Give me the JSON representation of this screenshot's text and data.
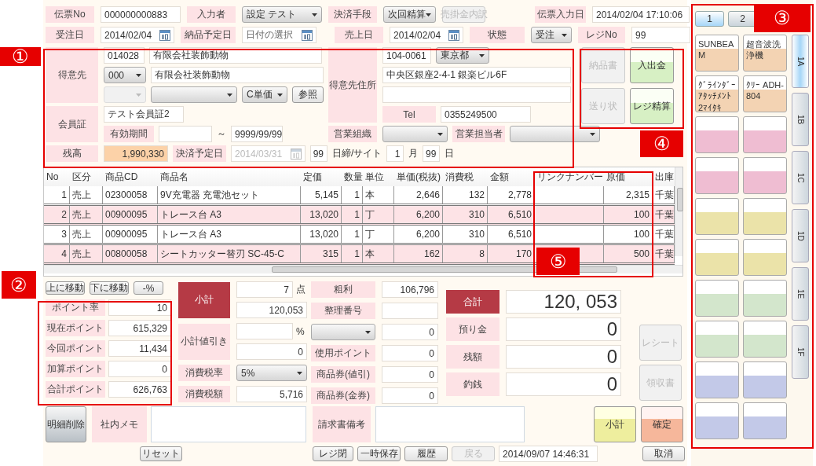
{
  "header_rows": [
    [
      {
        "kind": "label",
        "text": "伝票No"
      },
      {
        "kind": "field",
        "value": "000000000883"
      },
      {
        "kind": "label",
        "text": "入力者"
      },
      {
        "kind": "select",
        "value": "設定 テスト"
      },
      {
        "kind": "label",
        "text": "決済手段"
      },
      {
        "kind": "select",
        "value": "次回精算"
      },
      {
        "kind": "button",
        "text": "売掛金内訳",
        "disabled": true
      },
      {
        "kind": "label",
        "text": "伝票入力日"
      },
      {
        "kind": "field",
        "value": "2014/02/04 17:10:06"
      }
    ],
    [
      {
        "kind": "label",
        "text": "受注日"
      },
      {
        "kind": "date",
        "value": "2014/02/04"
      },
      {
        "kind": "label",
        "text": "納品予定日"
      },
      {
        "kind": "date",
        "placeholder": "日付の選択"
      },
      {
        "kind": "label",
        "text": "売上日"
      },
      {
        "kind": "date",
        "value": "2014/02/04"
      },
      {
        "kind": "label",
        "text": "状態"
      },
      {
        "kind": "select",
        "value": "受注"
      },
      {
        "kind": "label",
        "text": "レジNo"
      },
      {
        "kind": "field",
        "value": "99"
      }
    ]
  ],
  "customer": {
    "label": "得意先",
    "code": "014028",
    "name": "有限会社装飾動物",
    "branch": "000",
    "branch_name": "有限会社装飾動物",
    "sub_select_disabled": true,
    "price_type": "C単価",
    "lookup_button": "参照"
  },
  "member": {
    "label": "会員証",
    "value": "テスト会員証2",
    "period_label": "有効期間",
    "tilde": "～",
    "period_to": "9999/99/99"
  },
  "balance": {
    "label": "残高",
    "value": "1,990,330",
    "due_label": "決済予定日",
    "due_date": "2014/03/31",
    "due_disabled": true,
    "closing_day": "99",
    "closing_text": "日締/サイト",
    "site_month": "1",
    "month_text": "月",
    "site_day": "99",
    "day_text": "日"
  },
  "address": {
    "label": "得意先住所",
    "zip": "104-0061",
    "prefecture": "東京都",
    "line1": "中央区銀座2-4-1 銀楽ビル6F",
    "tel_label": "Tel",
    "tel": "0355249500"
  },
  "sales": {
    "org_label": "営業組織",
    "staff_label": "営業担当者"
  },
  "doc_buttons": [
    {
      "text": "納品書",
      "kind": "plain",
      "disabled": true
    },
    {
      "text": "入出金",
      "kind": "green",
      "disabled": false
    },
    {
      "text": "送り状",
      "kind": "plain",
      "disabled": true
    },
    {
      "text": "レジ精算",
      "kind": "green",
      "disabled": false
    }
  ],
  "table": {
    "columns": [
      "No",
      "区分",
      "商品CD",
      "商品名",
      "定価",
      "数量",
      "単位",
      "単価(税抜)",
      "消費税",
      "金額",
      "リンクナンバー",
      "原価",
      "出庫"
    ],
    "rows": [
      [
        "1",
        "売上",
        "02300058",
        "9V充電器 充電池セット",
        "5,145",
        "1",
        "本",
        "2,646",
        "132",
        "2,778",
        "",
        "2,315",
        "千葉"
      ],
      [
        "2",
        "売上",
        "00900095",
        "トレース台 A3",
        "13,020",
        "1",
        "丁",
        "6,200",
        "310",
        "6,510",
        "",
        "100",
        "千葉"
      ],
      [
        "3",
        "売上",
        "00900095",
        "トレース台 A3",
        "13,020",
        "1",
        "丁",
        "6,200",
        "310",
        "6,510",
        "",
        "100",
        "千葉"
      ],
      [
        "4",
        "売上",
        "00800058",
        "シートカッター替刃 SC-45-C",
        "315",
        "1",
        "本",
        "162",
        "8",
        "170",
        "",
        "500",
        "千葉"
      ]
    ]
  },
  "move_buttons": [
    "上に移動",
    "下に移動",
    "-%"
  ],
  "points": [
    {
      "label": "ポイント率",
      "value": "10"
    },
    {
      "label": "現在ポイント",
      "value": "615,329"
    },
    {
      "label": "今回ポイント",
      "value": "11,434"
    },
    {
      "label": "加算ポイント",
      "value": "0"
    },
    {
      "label": "合計ポイント",
      "value": "626,763"
    }
  ],
  "subtotal": {
    "label": "小計",
    "count": "7",
    "count_unit": "点",
    "amount": "120,053"
  },
  "discount": {
    "label": "小計値引き",
    "percent_unit": "%",
    "amount": "0"
  },
  "tax": {
    "rate_label": "消費税率",
    "rate": "5%",
    "amount_label": "消費税額",
    "amount": "5,716"
  },
  "misc": [
    {
      "kind": "label",
      "label": "粗利",
      "value": "106,796"
    },
    {
      "kind": "label",
      "label": "整理番号"
    },
    {
      "kind": "select",
      "value": "0"
    },
    {
      "kind": "label",
      "label": "使用ポイント",
      "value": "0"
    },
    {
      "kind": "label",
      "label": "商品券(値引)",
      "value": "0"
    },
    {
      "kind": "label",
      "label": "商品券(金券)",
      "value": "0"
    }
  ],
  "totals": [
    {
      "kind": "total",
      "label": "合計",
      "value": "120, 053"
    },
    {
      "kind": "plain",
      "label": "預り金",
      "value": "0"
    },
    {
      "kind": "plain",
      "label": "残額",
      "value": "0"
    },
    {
      "kind": "plain",
      "label": "釣銭",
      "value": "0"
    }
  ],
  "print_buttons": [
    {
      "text": "レシート",
      "disabled": true
    },
    {
      "text": "領収書",
      "disabled": true
    }
  ],
  "delete_button": "明細削除",
  "memo_label": "社内メモ",
  "invoice_note_label": "請求書備考",
  "action_buttons": [
    {
      "text": "小計",
      "kind": "yellow"
    },
    {
      "text": "確定",
      "kind": "orange"
    }
  ],
  "reset_button": "リセット",
  "footer_buttons": [
    {
      "text": "レジ閉",
      "disabled": false
    },
    {
      "text": "一時保存",
      "disabled": false
    },
    {
      "text": "履歴",
      "disabled": false
    },
    {
      "text": "戻る",
      "disabled": true
    }
  ],
  "clock": "2014/09/07 14:46:31",
  "cancel_button": "取消",
  "panel": {
    "tabs": [
      {
        "label": "1",
        "selected": true
      },
      {
        "label": "2",
        "selected": false
      }
    ],
    "products": [
      {
        "text": "SUNBEAM",
        "color": "#f3d3b3"
      },
      {
        "text": "超音波洗浄機",
        "color": "#f3d3b3"
      },
      {
        "text": "ｸﾞﾗｲﾝﾀﾞｰｱﾀｯﾁﾒﾝﾄ2ﾏｲﾀｷ",
        "color": "#f3d3b3"
      },
      {
        "text": "ｸﾘｰ ADH-804",
        "color": "#f3d3b3"
      },
      {
        "color": "#efbdd2"
      },
      {
        "color": "#efbdd2"
      },
      {
        "color": "#efbdd2"
      },
      {
        "color": "#efbdd2"
      },
      {
        "color": "#ebe3a9"
      },
      {
        "color": "#ebe3a9"
      },
      {
        "color": "#ebe3a9"
      },
      {
        "color": "#ebe3a9"
      },
      {
        "color": "#d3e6cc"
      },
      {
        "color": "#d3e6cc"
      },
      {
        "color": "#d3e6cc"
      },
      {
        "color": "#d3e6cc"
      },
      {
        "color": "#c3c9e8"
      },
      {
        "color": "#c3c9e8"
      },
      {
        "color": "#c3c9e8"
      },
      {
        "color": "#c3c9e8"
      }
    ],
    "side_tabs": [
      {
        "label": "1A",
        "selected": true
      },
      {
        "label": "1B",
        "selected": false
      },
      {
        "label": "1C",
        "selected": false
      },
      {
        "label": "1D",
        "selected": false
      },
      {
        "label": "1E",
        "selected": false
      },
      {
        "label": "1F",
        "selected": false
      }
    ]
  },
  "callouts": [
    {
      "label": "①"
    },
    {
      "label": "②"
    },
    {
      "label": "③"
    },
    {
      "label": "④"
    },
    {
      "label": "⑤"
    }
  ]
}
